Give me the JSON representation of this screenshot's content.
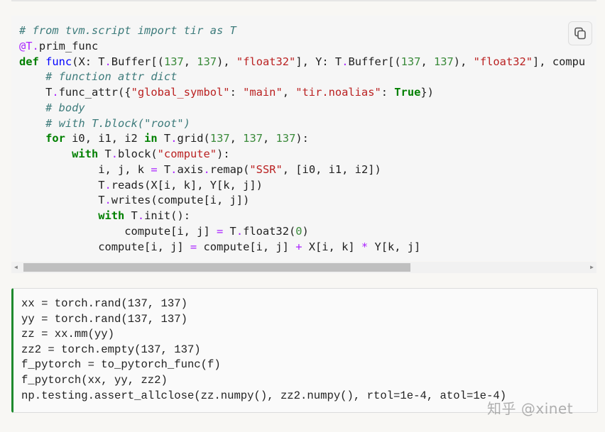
{
  "code_block_1": {
    "copy_icon": "copy-icon",
    "lines": [
      [
        [
          "c",
          "# from tvm.script import tir as T"
        ]
      ],
      [
        [
          "d",
          "@T"
        ],
        [
          "o",
          "."
        ],
        [
          "n",
          "prim_func"
        ]
      ],
      [
        [
          "k",
          "def"
        ],
        [
          "n",
          " "
        ],
        [
          "f",
          "func"
        ],
        [
          "n",
          "(X: T"
        ],
        [
          "o",
          "."
        ],
        [
          "n",
          "Buffer[("
        ],
        [
          "m",
          "137"
        ],
        [
          "n",
          ", "
        ],
        [
          "m",
          "137"
        ],
        [
          "n",
          "), "
        ],
        [
          "s",
          "\"float32\""
        ],
        [
          "n",
          "], Y: T"
        ],
        [
          "o",
          "."
        ],
        [
          "n",
          "Buffer[("
        ],
        [
          "m",
          "137"
        ],
        [
          "n",
          ", "
        ],
        [
          "m",
          "137"
        ],
        [
          "n",
          "), "
        ],
        [
          "s",
          "\"float32\""
        ],
        [
          "n",
          "], compu"
        ]
      ],
      [
        [
          "n",
          "    "
        ],
        [
          "c",
          "# function attr dict"
        ]
      ],
      [
        [
          "n",
          "    T"
        ],
        [
          "o",
          "."
        ],
        [
          "n",
          "func_attr({"
        ],
        [
          "s",
          "\"global_symbol\""
        ],
        [
          "n",
          ": "
        ],
        [
          "s",
          "\"main\""
        ],
        [
          "n",
          ", "
        ],
        [
          "s",
          "\"tir.noalias\""
        ],
        [
          "n",
          ": "
        ],
        [
          "k",
          "True"
        ],
        [
          "n",
          "})"
        ]
      ],
      [
        [
          "n",
          "    "
        ],
        [
          "c",
          "# body"
        ]
      ],
      [
        [
          "n",
          "    "
        ],
        [
          "c",
          "# with T.block(\"root\")"
        ]
      ],
      [
        [
          "n",
          "    "
        ],
        [
          "k",
          "for"
        ],
        [
          "n",
          " i0, i1, i2 "
        ],
        [
          "k",
          "in"
        ],
        [
          "n",
          " T"
        ],
        [
          "o",
          "."
        ],
        [
          "n",
          "grid("
        ],
        [
          "m",
          "137"
        ],
        [
          "n",
          ", "
        ],
        [
          "m",
          "137"
        ],
        [
          "n",
          ", "
        ],
        [
          "m",
          "137"
        ],
        [
          "n",
          "):"
        ]
      ],
      [
        [
          "n",
          "        "
        ],
        [
          "k",
          "with"
        ],
        [
          "n",
          " T"
        ],
        [
          "o",
          "."
        ],
        [
          "n",
          "block("
        ],
        [
          "s",
          "\"compute\""
        ],
        [
          "n",
          "):"
        ]
      ],
      [
        [
          "n",
          "            i, j, k "
        ],
        [
          "o",
          "="
        ],
        [
          "n",
          " T"
        ],
        [
          "o",
          "."
        ],
        [
          "n",
          "axis"
        ],
        [
          "o",
          "."
        ],
        [
          "n",
          "remap("
        ],
        [
          "s",
          "\"SSR\""
        ],
        [
          "n",
          ", [i0, i1, i2])"
        ]
      ],
      [
        [
          "n",
          "            T"
        ],
        [
          "o",
          "."
        ],
        [
          "n",
          "reads(X[i, k], Y[k, j])"
        ]
      ],
      [
        [
          "n",
          "            T"
        ],
        [
          "o",
          "."
        ],
        [
          "n",
          "writes(compute[i, j])"
        ]
      ],
      [
        [
          "n",
          "            "
        ],
        [
          "k",
          "with"
        ],
        [
          "n",
          " T"
        ],
        [
          "o",
          "."
        ],
        [
          "n",
          "init():"
        ]
      ],
      [
        [
          "n",
          "                compute[i, j] "
        ],
        [
          "o",
          "="
        ],
        [
          "n",
          " T"
        ],
        [
          "o",
          "."
        ],
        [
          "n",
          "float32("
        ],
        [
          "m",
          "0"
        ],
        [
          "n",
          ")"
        ]
      ],
      [
        [
          "n",
          "            compute[i, j] "
        ],
        [
          "o",
          "="
        ],
        [
          "n",
          " compute[i, j] "
        ],
        [
          "o",
          "+"
        ],
        [
          "n",
          " X[i, k] "
        ],
        [
          "o",
          "*"
        ],
        [
          "n",
          " Y[k, j]"
        ]
      ]
    ],
    "scroll_position_fraction": 0.0
  },
  "code_block_2": {
    "lines": [
      "xx = torch.rand(137, 137)",
      "yy = torch.rand(137, 137)",
      "zz = xx.mm(yy)",
      "zz2 = torch.empty(137, 137)",
      "f_pytorch = to_pytorch_func(f)",
      "f_pytorch(xx, yy, zz2)",
      "np.testing.assert_allclose(zz.numpy(), zz2.numpy(), rtol=1e-4, atol=1e-4)"
    ],
    "accent_color": "#1e8a2e"
  },
  "watermark": "知乎 @xinet"
}
